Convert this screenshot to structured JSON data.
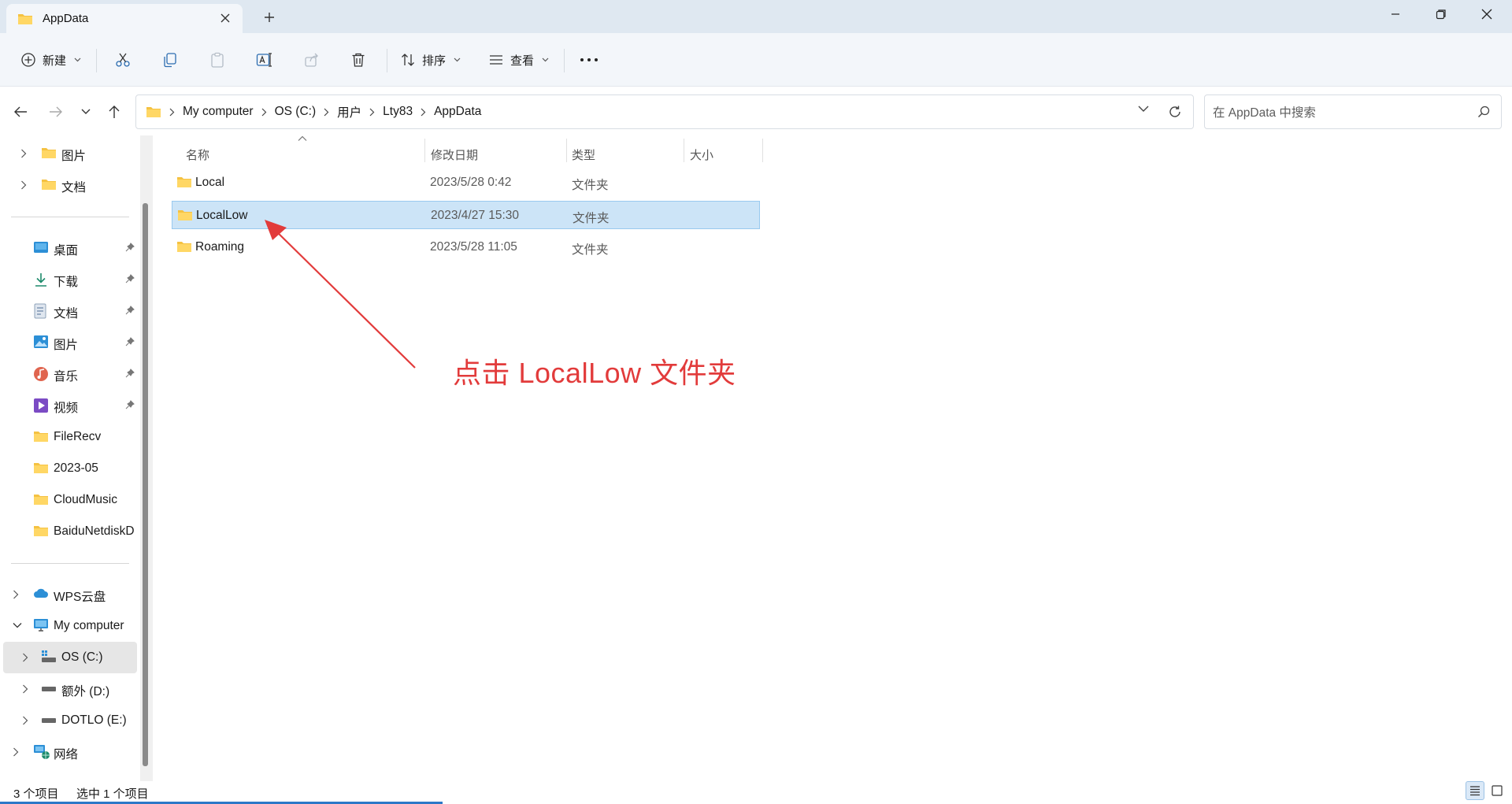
{
  "window": {
    "tab_title": "AppData"
  },
  "toolbar": {
    "new_label": "新建",
    "sort_label": "排序",
    "view_label": "查看"
  },
  "address": {
    "crumbs": [
      "My computer",
      "OS (C:)",
      "用户",
      "Lty83",
      "AppData"
    ]
  },
  "search": {
    "placeholder": "在 AppData 中搜索"
  },
  "sidebar": {
    "top_items": [
      {
        "label": "图片",
        "icon": "folder-icon"
      },
      {
        "label": "文档",
        "icon": "folder-icon"
      }
    ],
    "quick_access": [
      {
        "label": "桌面",
        "icon": "desktop-icon",
        "pinned": true
      },
      {
        "label": "下载",
        "icon": "download-icon",
        "pinned": true
      },
      {
        "label": "文档",
        "icon": "document-icon",
        "pinned": true
      },
      {
        "label": "图片",
        "icon": "pictures-icon",
        "pinned": true
      },
      {
        "label": "音乐",
        "icon": "music-icon",
        "pinned": true
      },
      {
        "label": "视频",
        "icon": "video-icon",
        "pinned": true
      },
      {
        "label": "FileRecv",
        "icon": "folder-icon",
        "pinned": false
      },
      {
        "label": "2023-05",
        "icon": "folder-icon",
        "pinned": false
      },
      {
        "label": "CloudMusic",
        "icon": "folder-icon",
        "pinned": false
      },
      {
        "label": "BaiduNetdiskD",
        "icon": "folder-icon",
        "pinned": false
      }
    ],
    "devices": [
      {
        "label": "WPS云盘",
        "icon": "cloud-icon"
      },
      {
        "label": "My computer",
        "icon": "computer-icon"
      },
      {
        "label": "OS (C:)",
        "icon": "drive-icon"
      },
      {
        "label": "额外 (D:)",
        "icon": "drive-icon"
      },
      {
        "label": "DOTLO (E:)",
        "icon": "drive-icon"
      },
      {
        "label": "网络",
        "icon": "network-icon"
      }
    ]
  },
  "filelist": {
    "columns": [
      "名称",
      "修改日期",
      "类型",
      "大小"
    ],
    "rows": [
      {
        "name": "Local",
        "date": "2023/5/28 0:42",
        "type": "文件夹",
        "size": ""
      },
      {
        "name": "LocalLow",
        "date": "2023/4/27 15:30",
        "type": "文件夹",
        "size": ""
      },
      {
        "name": "Roaming",
        "date": "2023/5/28 11:05",
        "type": "文件夹",
        "size": ""
      }
    ],
    "selected_index": 1
  },
  "annotation": {
    "text": "点击  LocalLow 文件夹",
    "color": "#e23b3b"
  },
  "status": {
    "count": "3 个项目",
    "selection": "选中 1 个项目"
  },
  "colors": {
    "folder": "#f5c242",
    "accent": "#2c78c8",
    "selection": "#cce4f7"
  }
}
